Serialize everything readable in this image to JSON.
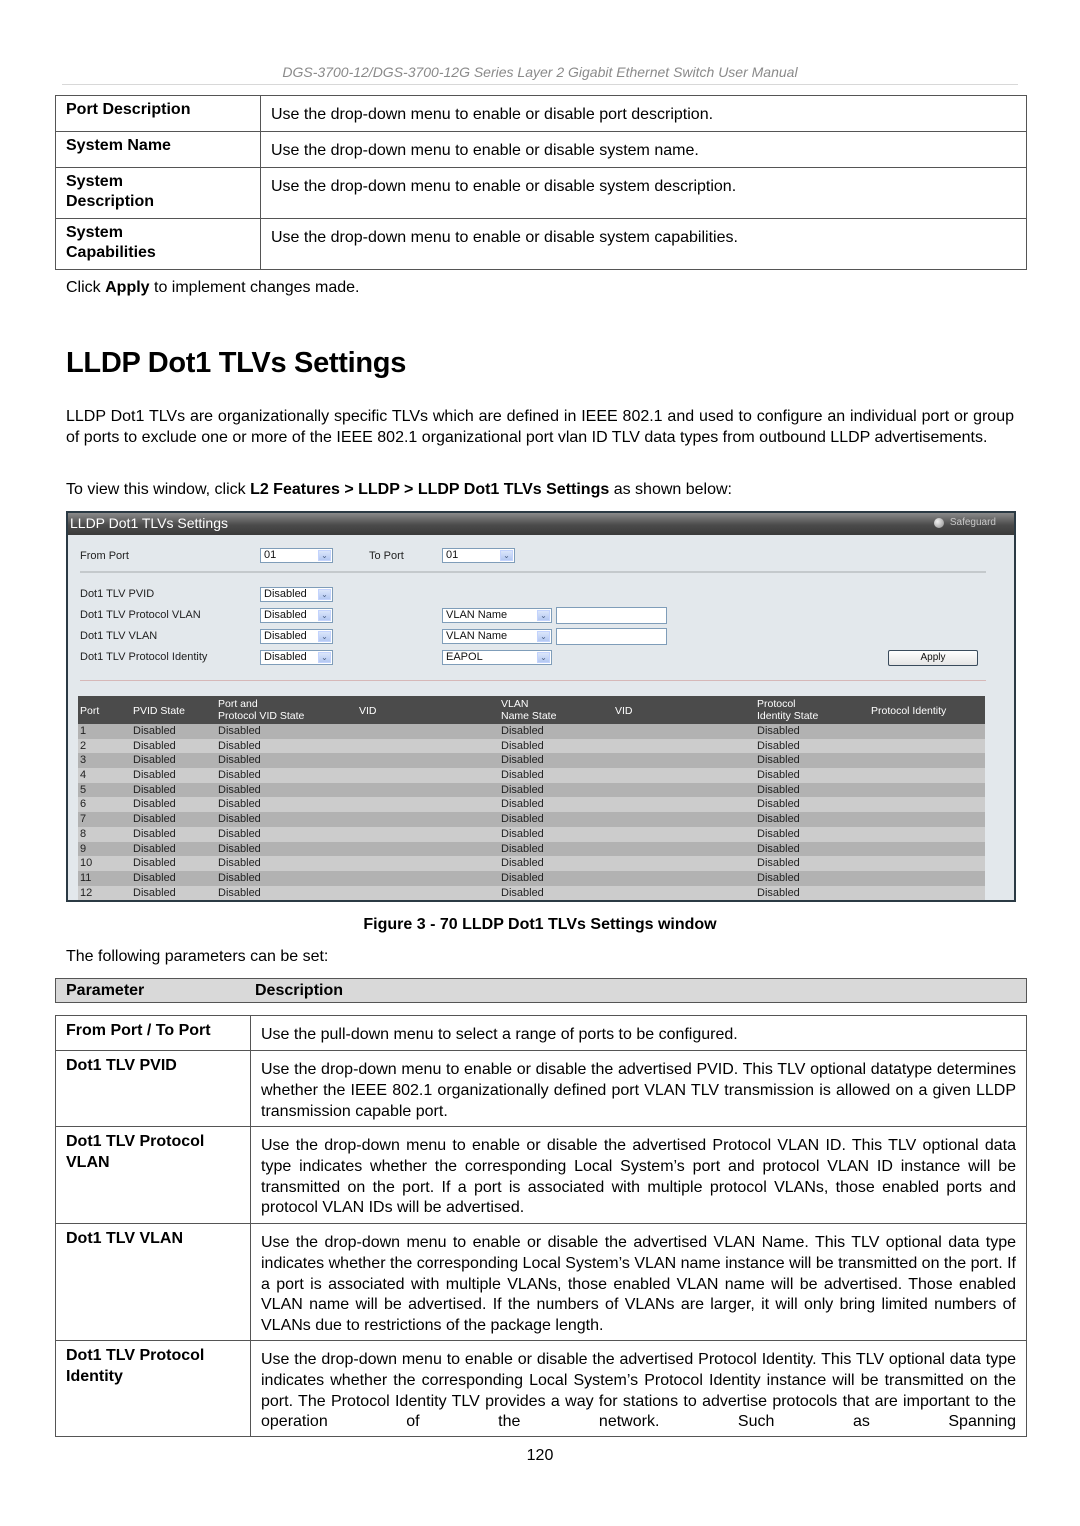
{
  "running_header": "DGS-3700-12/DGS-3700-12G Series Layer 2 Gigabit Ethernet Switch User Manual",
  "top_table": [
    {
      "param": "Port Description",
      "desc": "Use the drop-down menu to enable or disable port description."
    },
    {
      "param": "System Name",
      "desc": "Use the drop-down menu to enable or disable system name."
    },
    {
      "param": "System Description",
      "desc": "Use the drop-down menu to enable or disable system description."
    },
    {
      "param": "System Capabilities",
      "desc": "Use the drop-down menu to enable or disable system capabilities."
    }
  ],
  "apply_note": {
    "pre": "Click ",
    "bold": "Apply",
    "post": " to implement changes made."
  },
  "section_title": "LLDP Dot1 TLVs Settings",
  "intro": "LLDP Dot1 TLVs are organizationally specific TLVs which are defined in IEEE 802.1 and used to configure an individual port or group of ports to exclude one or more of the IEEE 802.1 organizational port vlan ID TLV data types from outbound LLDP advertisements.",
  "nav_note": {
    "pre": "To view this window, click ",
    "bold": "L2 Features > LLDP > LLDP Dot1 TLVs Settings",
    "post": " as shown below:"
  },
  "window": {
    "title": "LLDP Dot1 TLVs Settings",
    "safeguard": "Safeguard",
    "from_port_label": "From Port",
    "from_port_value": "01",
    "to_port_label": "To Port",
    "to_port_value": "01",
    "rows": [
      {
        "label": "Dot1 TLV PVID",
        "state": "Disabled"
      },
      {
        "label": "Dot1 TLV Protocol VLAN",
        "state": "Disabled",
        "type": "VLAN Name",
        "text": ""
      },
      {
        "label": "Dot1 TLV VLAN",
        "state": "Disabled",
        "type": "VLAN Name",
        "text": ""
      },
      {
        "label": "Dot1 TLV Protocol Identity",
        "state": "Disabled",
        "type": "EAPOL"
      }
    ],
    "apply_label": "Apply",
    "table": {
      "headers": [
        "Port",
        "PVID State",
        "Port and\nProtocol VID State",
        "VID",
        "VLAN\nName State",
        "VID",
        "Protocol\nIdentity State",
        "Protocol Identity"
      ],
      "rows": [
        [
          "1",
          "Disabled",
          "Disabled",
          "",
          "Disabled",
          "",
          "Disabled",
          ""
        ],
        [
          "2",
          "Disabled",
          "Disabled",
          "",
          "Disabled",
          "",
          "Disabled",
          ""
        ],
        [
          "3",
          "Disabled",
          "Disabled",
          "",
          "Disabled",
          "",
          "Disabled",
          ""
        ],
        [
          "4",
          "Disabled",
          "Disabled",
          "",
          "Disabled",
          "",
          "Disabled",
          ""
        ],
        [
          "5",
          "Disabled",
          "Disabled",
          "",
          "Disabled",
          "",
          "Disabled",
          ""
        ],
        [
          "6",
          "Disabled",
          "Disabled",
          "",
          "Disabled",
          "",
          "Disabled",
          ""
        ],
        [
          "7",
          "Disabled",
          "Disabled",
          "",
          "Disabled",
          "",
          "Disabled",
          ""
        ],
        [
          "8",
          "Disabled",
          "Disabled",
          "",
          "Disabled",
          "",
          "Disabled",
          ""
        ],
        [
          "9",
          "Disabled",
          "Disabled",
          "",
          "Disabled",
          "",
          "Disabled",
          ""
        ],
        [
          "10",
          "Disabled",
          "Disabled",
          "",
          "Disabled",
          "",
          "Disabled",
          ""
        ],
        [
          "11",
          "Disabled",
          "Disabled",
          "",
          "Disabled",
          "",
          "Disabled",
          ""
        ],
        [
          "12",
          "Disabled",
          "Disabled",
          "",
          "Disabled",
          "",
          "Disabled",
          ""
        ]
      ]
    }
  },
  "figure_caption": "Figure 3 - 70 LLDP Dot1 TLVs Settings window",
  "params_intro": "The following parameters can be set:",
  "param_table": {
    "header_param": "Parameter",
    "header_desc": "Description",
    "rows": [
      {
        "param": "From Port / To Port",
        "desc": "Use the pull-down menu to select a range of ports to be configured."
      },
      {
        "param": "Dot1 TLV PVID",
        "desc": "Use the drop-down menu to enable or disable the advertised PVID. This TLV optional datatype determines whether the IEEE 802.1 organizationally defined port VLAN TLV transmission is allowed on a given LLDP transmission capable port."
      },
      {
        "param": "Dot1 TLV Protocol VLAN",
        "desc": "Use the drop-down menu to enable or disable the advertised Protocol VLAN ID. This TLV optional data type indicates whether the corresponding Local System’s port and protocol VLAN ID instance will be transmitted on the port. If a port is associated with multiple protocol VLANs, those enabled ports and protocol VLAN IDs will be advertised."
      },
      {
        "param": "Dot1 TLV VLAN",
        "desc": "Use the drop-down menu to enable or disable the advertised VLAN Name. This TLV optional data type indicates whether the corresponding Local System’s VLAN name instance will be transmitted on the port. If a port is associated with multiple VLANs, those enabled VLAN name will be advertised. Those enabled VLAN name will be advertised. If the numbers of VLANs are larger, it will only bring limited numbers of VLANs due to restrictions of the package length."
      },
      {
        "param": "Dot1 TLV Protocol Identity",
        "desc": "Use the drop-down menu to enable or disable the advertised Protocol Identity. This TLV optional data type indicates whether the corresponding Local System’s Protocol Identity instance will be transmitted on the port. The Protocol Identity TLV provides a way for stations to advertise protocols that are important to the operation of the network. Such as Spanning"
      }
    ]
  },
  "page_number": "120",
  "colors": {
    "panel_bg": "#e3e8ec",
    "panel_header": "#4b4b4b",
    "grid_header": "#4b4b4b",
    "row_odd": "#b2b2b2",
    "row_even": "#cccccc",
    "param_header_bg": "#d9d9d9"
  }
}
